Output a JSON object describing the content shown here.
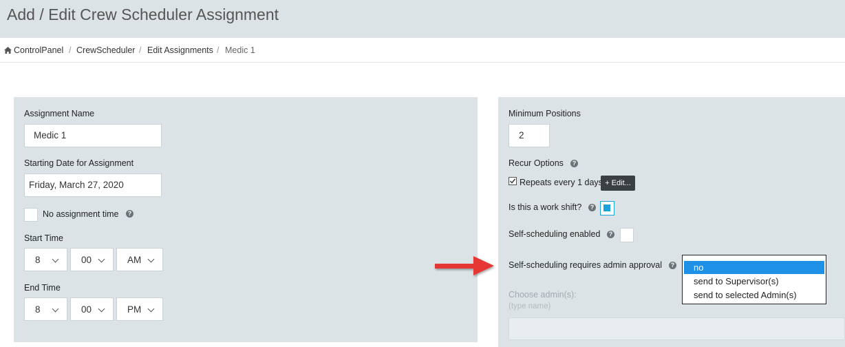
{
  "header": {
    "title": "Add / Edit Crew Scheduler Assignment"
  },
  "breadcrumb": [
    "ControlPanel",
    "CrewScheduler",
    "Edit Assignments",
    "Medic 1"
  ],
  "left": {
    "assignment_name_label": "Assignment Name",
    "assignment_name_value": "Medic 1",
    "start_date_label": "Starting Date for Assignment",
    "start_date_value": "Friday, March 27, 2020",
    "no_time_label": "No assignment time",
    "start_time_label": "Start Time",
    "start_hour": "8",
    "start_min": "00",
    "start_ampm": "AM",
    "end_time_label": "End Time",
    "end_hour": "8",
    "end_min": "00",
    "end_ampm": "PM"
  },
  "right": {
    "min_positions_label": "Minimum Positions",
    "min_positions_value": "2",
    "recur_label": "Recur Options",
    "repeats_text": "Repeats every 1 days",
    "edit_button": "+ Edit...",
    "work_shift_label": "Is this a work shift?",
    "self_sched_label": "Self-scheduling enabled",
    "approval_label": "Self-scheduling requires admin approval",
    "choose_admin_label": "Choose admin(s):",
    "choose_admin_hint": "(type name)"
  },
  "approval_dropdown": {
    "options": [
      "no",
      "send to Supervisor(s)",
      "send to selected Admin(s)"
    ],
    "selected": "no"
  },
  "colors": {
    "panel": "#dce3e6",
    "highlight": "#1e90e6",
    "arrow": "#e53935",
    "checkbox_accent": "#1aa3d9"
  },
  "icons": [
    "home-icon",
    "help-icon",
    "chevron-down-icon",
    "checkmark-icon",
    "red-arrow-icon"
  ]
}
